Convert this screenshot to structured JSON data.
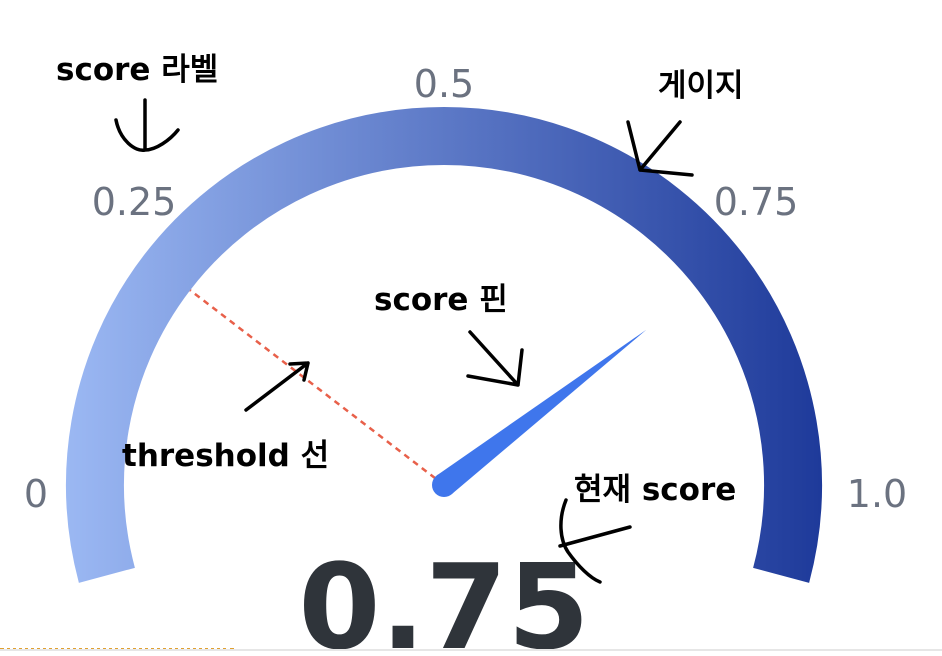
{
  "gauge": {
    "min": 0,
    "max": 1,
    "value": 0.75,
    "threshold": 0.25,
    "tick_labels": [
      "0",
      "0.25",
      "0.5",
      "0.75",
      "1.0"
    ],
    "value_label": "0.75",
    "gradient_start_color": "#9bb8f3",
    "gradient_end_color": "#1e3a9a",
    "needle_color": "#3f76ec",
    "threshold_color": "#e8604a"
  },
  "annotations": {
    "score_labels": "score 라벨",
    "gauge": "게이지",
    "score_pin": "score 핀",
    "threshold_line": "threshold 선",
    "current_score": "현재 score"
  }
}
